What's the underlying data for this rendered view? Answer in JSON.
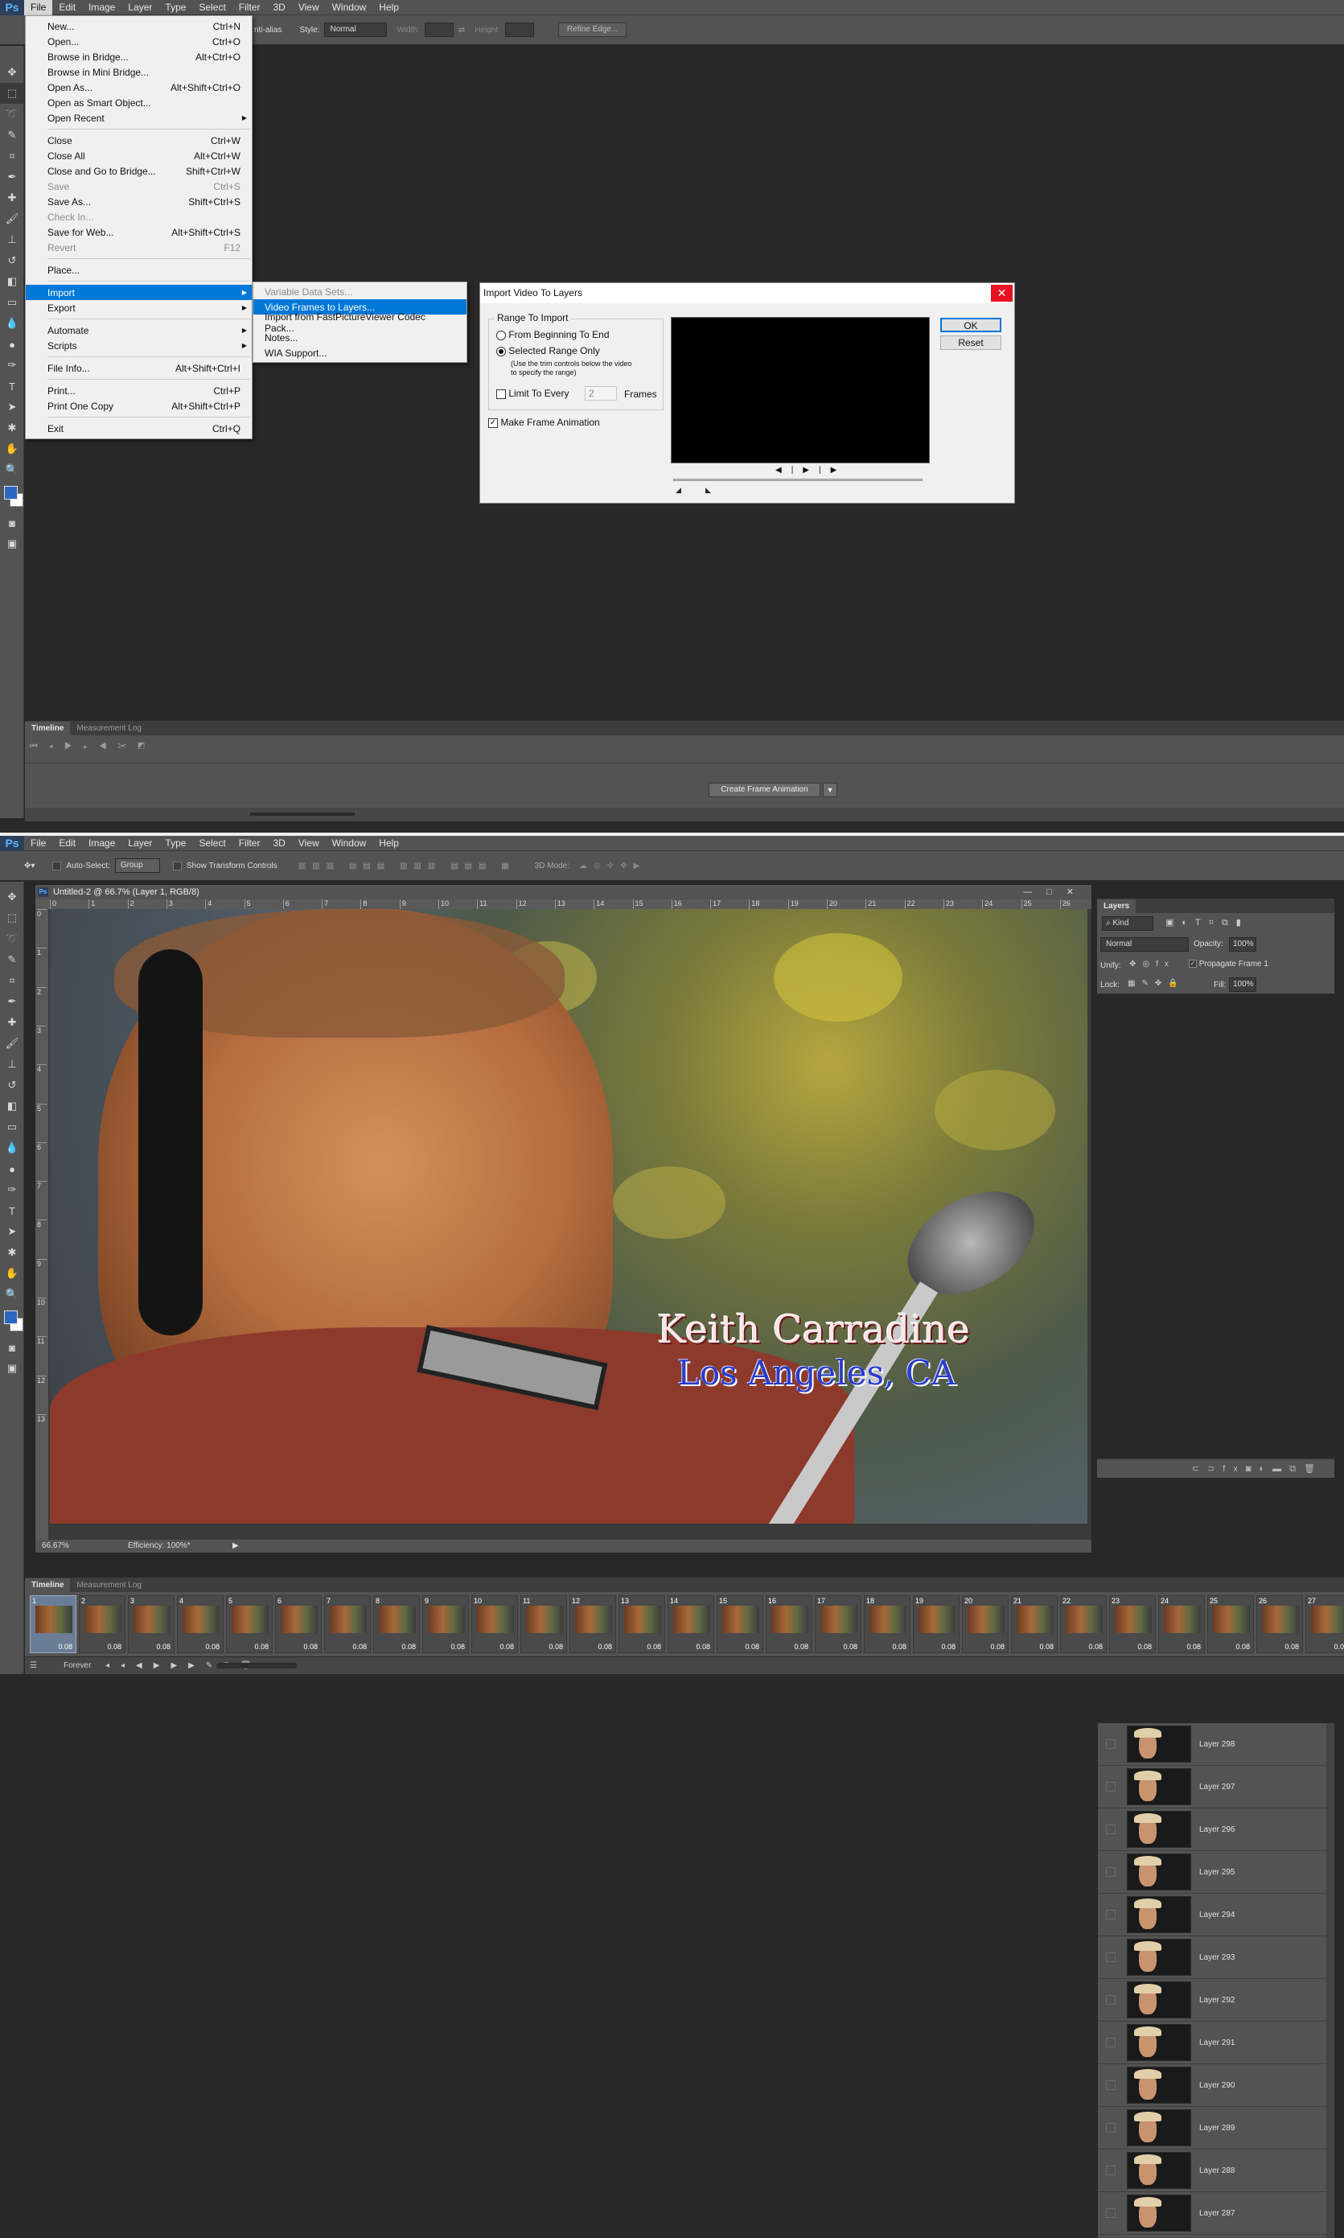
{
  "top": {
    "menubar": {
      "logo": "Ps",
      "items": [
        "File",
        "Edit",
        "Image",
        "Layer",
        "Type",
        "Select",
        "Filter",
        "3D",
        "View",
        "Window",
        "Help"
      ]
    },
    "options": {
      "antialias_label": "nti-alias",
      "style_label": "Style:",
      "style_value": "Normal",
      "width_label": "Width:",
      "height_label": "Height:",
      "refine_edge": "Refine Edge..."
    },
    "file_menu": {
      "items": [
        {
          "label": "New...",
          "shortcut": "Ctrl+N"
        },
        {
          "label": "Open...",
          "shortcut": "Ctrl+O"
        },
        {
          "label": "Browse in Bridge...",
          "shortcut": "Alt+Ctrl+O"
        },
        {
          "label": "Browse in Mini Bridge...",
          "shortcut": ""
        },
        {
          "label": "Open As...",
          "shortcut": "Alt+Shift+Ctrl+O"
        },
        {
          "label": "Open as Smart Object...",
          "shortcut": ""
        },
        {
          "label": "Open Recent",
          "shortcut": ""
        },
        {
          "label": "Close",
          "shortcut": "Ctrl+W"
        },
        {
          "label": "Close All",
          "shortcut": "Alt+Ctrl+W"
        },
        {
          "label": "Close and Go to Bridge...",
          "shortcut": "Shift+Ctrl+W"
        },
        {
          "label": "Save",
          "shortcut": "Ctrl+S"
        },
        {
          "label": "Save As...",
          "shortcut": "Shift+Ctrl+S"
        },
        {
          "label": "Check In...",
          "shortcut": ""
        },
        {
          "label": "Save for Web...",
          "shortcut": "Alt+Shift+Ctrl+S"
        },
        {
          "label": "Revert",
          "shortcut": "F12"
        },
        {
          "label": "Place...",
          "shortcut": ""
        },
        {
          "label": "Import",
          "shortcut": ""
        },
        {
          "label": "Export",
          "shortcut": ""
        },
        {
          "label": "Automate",
          "shortcut": ""
        },
        {
          "label": "Scripts",
          "shortcut": ""
        },
        {
          "label": "File Info...",
          "shortcut": "Alt+Shift+Ctrl+I"
        },
        {
          "label": "Print...",
          "shortcut": "Ctrl+P"
        },
        {
          "label": "Print One Copy",
          "shortcut": "Alt+Shift+Ctrl+P"
        },
        {
          "label": "Exit",
          "shortcut": "Ctrl+Q"
        }
      ]
    },
    "import_submenu": {
      "items": [
        "Variable Data Sets...",
        "Video Frames to Layers...",
        "Import from FastPictureViewer Codec Pack...",
        "Notes...",
        "WIA Support..."
      ]
    },
    "dialog": {
      "title": "Import Video To Layers",
      "close": "✕",
      "range_legend": "Range To Import",
      "from_beginning": "From Beginning To End",
      "selected_range": "Selected Range Only",
      "hint": "(Use the trim controls below the video to specify the range)",
      "limit_label": "Limit To Every",
      "limit_value": "2",
      "frames_label": "Frames",
      "make_frame_animation": "Make Frame Animation",
      "ok": "OK",
      "reset": "Reset"
    },
    "timeline": {
      "tabs": [
        "Timeline",
        "Measurement Log"
      ],
      "create_button": "Create Frame Animation"
    }
  },
  "bottom": {
    "menubar": {
      "logo": "Ps",
      "items": [
        "File",
        "Edit",
        "Image",
        "Layer",
        "Type",
        "Select",
        "Filter",
        "3D",
        "View",
        "Window",
        "Help"
      ]
    },
    "options": {
      "auto_select": "Auto-Select:",
      "group": "Group",
      "show_transform": "Show Transform Controls",
      "mode_3d": "3D Mode:"
    },
    "document": {
      "title": "Untitled-2 @ 66.7% (Layer 1, RGB/8)",
      "zoom": "66.67%",
      "efficiency": "Efficiency: 100%*",
      "caption_name": "Keith Carradine",
      "caption_place": "Los Angeles, CA",
      "ruler_ticks": [
        "0",
        "1",
        "2",
        "3",
        "4",
        "5",
        "6",
        "7",
        "8",
        "9",
        "10",
        "11",
        "12",
        "13",
        "14",
        "15",
        "16",
        "17",
        "18",
        "19",
        "20",
        "21",
        "22",
        "23",
        "24",
        "25",
        "26"
      ],
      "vruler_ticks": [
        "0",
        "1",
        "2",
        "3",
        "4",
        "5",
        "6",
        "7",
        "8",
        "9",
        "10",
        "11",
        "12",
        "13"
      ]
    },
    "layers_panel": {
      "title": "Layers",
      "kind": "Kind",
      "blend": "Normal",
      "opacity_label": "Opacity:",
      "opacity": "100%",
      "unify_label": "Unify:",
      "propagate": "Propagate Frame 1",
      "lock_label": "Lock:",
      "fill_label": "Fill:",
      "fill": "100%",
      "layers": [
        "Layer 298",
        "Layer 297",
        "Layer 296",
        "Layer 295",
        "Layer 294",
        "Layer 293",
        "Layer 292",
        "Layer 291",
        "Layer 290",
        "Layer 289",
        "Layer 288",
        "Layer 287"
      ]
    },
    "timeline": {
      "tabs": [
        "Timeline",
        "Measurement Log"
      ],
      "frame_duration": "0.08",
      "frames": [
        "1",
        "2",
        "3",
        "4",
        "5",
        "6",
        "7",
        "8",
        "9",
        "10",
        "11",
        "12",
        "13",
        "14",
        "15",
        "16",
        "17",
        "18",
        "19",
        "20",
        "21",
        "22",
        "23",
        "24",
        "25",
        "26",
        "27"
      ],
      "loop": "Forever"
    }
  }
}
